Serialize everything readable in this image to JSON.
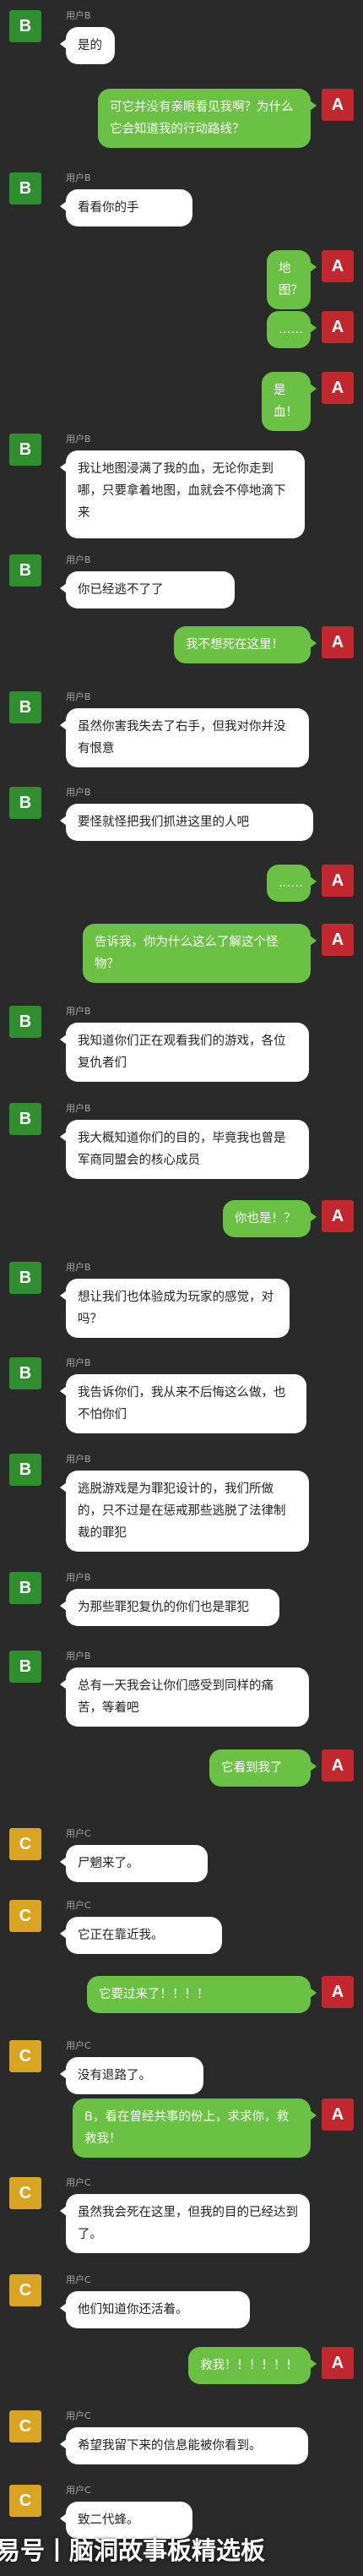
{
  "colors": {
    "background": "#2a2a2a",
    "outgoing_bubble": "#6ac144",
    "incoming_bubble": "#ffffff"
  },
  "watermark": "网易号丨脑洞故事板精选板",
  "messages": [
    {
      "side": "left",
      "avatar": "B",
      "avatar_color": "#2f8f2f",
      "name": "用户B",
      "text": "是的"
    },
    {
      "side": "right",
      "avatar": "A",
      "avatar_color": "#c1272d",
      "text": "可它并没有亲眼看见我啊？为什么它会知道我的行动路线？"
    },
    {
      "side": "left",
      "avatar": "B",
      "avatar_color": "#2f8f2f",
      "name": "用户B",
      "text": "看看你的手"
    },
    {
      "side": "right",
      "avatar": "A",
      "avatar_color": "#c1272d",
      "text": "地图？"
    },
    {
      "side": "right",
      "avatar": "A",
      "avatar_color": "#c1272d",
      "text": "……"
    },
    {
      "side": "right",
      "avatar": "A",
      "avatar_color": "#c1272d",
      "text": "是血！"
    },
    {
      "side": "left",
      "avatar": "B",
      "avatar_color": "#2f8f2f",
      "name": "用户B",
      "text": "我让地图浸满了我的血，无论你走到哪，只要拿着地图，血就会不停地滴下来"
    },
    {
      "side": "left",
      "avatar": "B",
      "avatar_color": "#2f8f2f",
      "name": "用户B",
      "text": "你已经逃不了了"
    },
    {
      "side": "right",
      "avatar": "A",
      "avatar_color": "#c1272d",
      "text": "我不想死在这里！"
    },
    {
      "side": "left",
      "avatar": "B",
      "avatar_color": "#2f8f2f",
      "name": "用户B",
      "text": "虽然你害我失去了右手，但我对你并没有恨意"
    },
    {
      "side": "left",
      "avatar": "B",
      "avatar_color": "#2f8f2f",
      "name": "用户B",
      "text": "要怪就怪把我们抓进这里的人吧"
    },
    {
      "side": "right",
      "avatar": "A",
      "avatar_color": "#c1272d",
      "text": "……"
    },
    {
      "side": "right",
      "avatar": "A",
      "avatar_color": "#c1272d",
      "text": "告诉我，你为什么这么了解这个怪物？"
    },
    {
      "side": "left",
      "avatar": "B",
      "avatar_color": "#2f8f2f",
      "name": "用户B",
      "text": "我知道你们正在观看我们的游戏，各位复仇者们"
    },
    {
      "side": "left",
      "avatar": "B",
      "avatar_color": "#2f8f2f",
      "name": "用户B",
      "text": "我大概知道你们的目的，毕竟我也曾是军商同盟会的核心成员"
    },
    {
      "side": "right",
      "avatar": "A",
      "avatar_color": "#c1272d",
      "text": "你也是！？"
    },
    {
      "side": "left",
      "avatar": "B",
      "avatar_color": "#2f8f2f",
      "name": "用户B",
      "text": "想让我们也体验成为玩家的感觉，对吗？"
    },
    {
      "side": "left",
      "avatar": "B",
      "avatar_color": "#2f8f2f",
      "name": "用户B",
      "text": "我告诉你们，我从来不后悔这么做，也不怕你们"
    },
    {
      "side": "left",
      "avatar": "B",
      "avatar_color": "#2f8f2f",
      "name": "用户B",
      "text": "逃脱游戏是为罪犯设计的，我们所做的，只不过是在惩戒那些逃脱了法律制裁的罪犯"
    },
    {
      "side": "left",
      "avatar": "B",
      "avatar_color": "#2f8f2f",
      "name": "用户B",
      "text": "为那些罪犯复仇的你们也是罪犯"
    },
    {
      "side": "left",
      "avatar": "B",
      "avatar_color": "#2f8f2f",
      "name": "用户B",
      "text": "总有一天我会让你们感受到同样的痛苦，等着吧"
    },
    {
      "side": "right",
      "avatar": "A",
      "avatar_color": "#c1272d",
      "text": "它看到我了"
    },
    {
      "side": "left",
      "avatar": "C",
      "avatar_color": "#d9a421",
      "name": "用户C",
      "text": "尸魍来了。"
    },
    {
      "side": "left",
      "avatar": "C",
      "avatar_color": "#d9a421",
      "name": "用户C",
      "text": "它正在靠近我。"
    },
    {
      "side": "right",
      "avatar": "A",
      "avatar_color": "#c1272d",
      "text": "它要过来了！！！！"
    },
    {
      "side": "left",
      "avatar": "C",
      "avatar_color": "#d9a421",
      "name": "用户C",
      "text": "没有退路了。"
    },
    {
      "side": "right",
      "avatar": "A",
      "avatar_color": "#c1272d",
      "text": "B，看在曾经共事的份上，求求你，救救我！"
    },
    {
      "side": "left",
      "avatar": "C",
      "avatar_color": "#d9a421",
      "name": "用户C",
      "text": "虽然我会死在这里，但我的目的已经达到了。"
    },
    {
      "side": "left",
      "avatar": "C",
      "avatar_color": "#d9a421",
      "name": "用户C",
      "text": "他们知道你还活着。"
    },
    {
      "side": "right",
      "avatar": "A",
      "avatar_color": "#c1272d",
      "text": "救我！！！！！！"
    },
    {
      "side": "left",
      "avatar": "C",
      "avatar_color": "#d9a421",
      "name": "用户C",
      "text": "希望我留下来的信息能被你看到。"
    },
    {
      "side": "left",
      "avatar": "C",
      "avatar_color": "#d9a421",
      "name": "用户C",
      "text": "致二代蜂。"
    }
  ]
}
